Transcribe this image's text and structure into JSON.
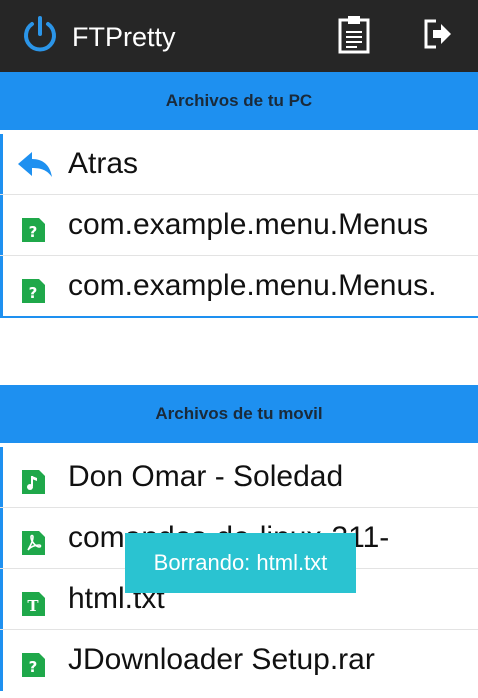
{
  "app": {
    "title": "FTPretty",
    "icons": {
      "logo": "power-logo-icon",
      "clipboard": "clipboard-icon",
      "exit": "exit-icon"
    }
  },
  "pc_section": {
    "title": "Archivos de tu PC",
    "items": [
      {
        "label": "Atras",
        "icon": "back-arrow-icon"
      },
      {
        "label": "com.example.menu.Menus",
        "icon": "unknown-file-icon"
      },
      {
        "label": "com.example.menu.Menus.",
        "icon": "unknown-file-icon"
      }
    ]
  },
  "mobile_section": {
    "title": "Archivos de tu movil",
    "items": [
      {
        "label": "Don Omar - Soledad",
        "icon": "music-file-icon"
      },
      {
        "label": "comandos-de-linux-311-",
        "icon": "pdf-file-icon"
      },
      {
        "label": "html.txt",
        "icon": "text-file-icon"
      },
      {
        "label": "JDownloader Setup.rar",
        "icon": "unknown-file-icon"
      }
    ]
  },
  "toast": {
    "text": "Borrando: html.txt"
  },
  "colors": {
    "actionbar": "#262626",
    "accent_blue": "#1e90f0",
    "file_green": "#1fa84a",
    "toast": "#2ac3d1"
  }
}
